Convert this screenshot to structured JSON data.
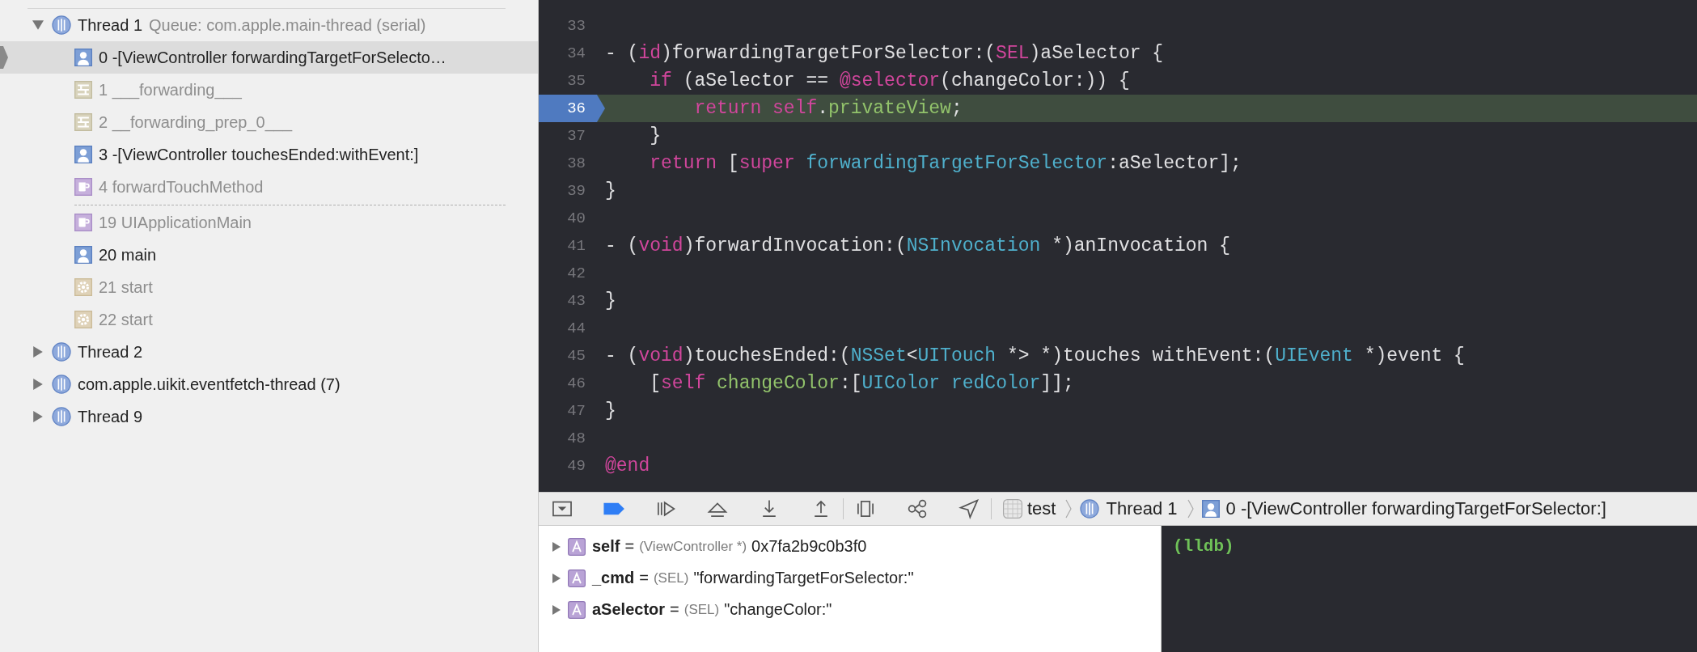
{
  "threads": [
    {
      "name": "Thread 1",
      "queue": "Queue: com.apple.main-thread (serial)",
      "expanded": true,
      "frames": [
        {
          "label": "0 -[ViewController forwardingTargetForSelecto…",
          "kind": "user",
          "dimmed": false,
          "selected": true,
          "elided_before": false
        },
        {
          "label": "1 ___forwarding___",
          "kind": "library",
          "dimmed": true,
          "selected": false,
          "elided_before": false
        },
        {
          "label": "2 __forwarding_prep_0___",
          "kind": "library",
          "dimmed": true,
          "selected": false,
          "elided_before": false
        },
        {
          "label": "3 -[ViewController touchesEnded:withEvent:]",
          "kind": "user",
          "dimmed": false,
          "selected": false,
          "elided_before": false
        },
        {
          "label": "4 forwardTouchMethod",
          "kind": "app",
          "dimmed": true,
          "selected": false,
          "elided_before": false
        },
        {
          "label": "19 UIApplicationMain",
          "kind": "app",
          "dimmed": true,
          "selected": false,
          "elided_before": true
        },
        {
          "label": "20 main",
          "kind": "user",
          "dimmed": false,
          "selected": false,
          "elided_before": false
        },
        {
          "label": "21 start",
          "kind": "system",
          "dimmed": true,
          "selected": false,
          "elided_before": false
        },
        {
          "label": "22 start",
          "kind": "system",
          "dimmed": true,
          "selected": false,
          "elided_before": false
        }
      ]
    },
    {
      "name": "Thread 2",
      "expanded": false
    },
    {
      "name": "com.apple.uikit.eventfetch-thread (7)",
      "expanded": false
    },
    {
      "name": "Thread 9",
      "expanded": false
    }
  ],
  "editor": {
    "lines": [
      {
        "number": "33",
        "current": false
      },
      {
        "number": "34",
        "current": false,
        "tokens": [
          {
            "text": "- (",
            "kind": "plain"
          },
          {
            "text": "id",
            "kind": "keyword"
          },
          {
            "text": ")forwardingTargetForSelector:(",
            "kind": "plain"
          },
          {
            "text": "SEL",
            "kind": "keyword"
          },
          {
            "text": ")aSelector {",
            "kind": "plain"
          }
        ]
      },
      {
        "number": "35",
        "current": false,
        "tokens": [
          {
            "text": "    if",
            "kind": "keyword"
          },
          {
            "text": " (aSelector == ",
            "kind": "plain"
          },
          {
            "text": "@selector",
            "kind": "keyword"
          },
          {
            "text": "(changeColor:)) {",
            "kind": "plain"
          }
        ]
      },
      {
        "number": "36",
        "current": true,
        "tokens": [
          {
            "text": "        return self",
            "kind": "keyword"
          },
          {
            "text": ".",
            "kind": "plain"
          },
          {
            "text": "privateView",
            "kind": "member"
          },
          {
            "text": ";",
            "kind": "plain"
          }
        ]
      },
      {
        "number": "37",
        "current": false,
        "tokens": [
          {
            "text": "    }",
            "kind": "plain"
          }
        ]
      },
      {
        "number": "38",
        "current": false,
        "tokens": [
          {
            "text": "    return",
            "kind": "keyword"
          },
          {
            "text": " [",
            "kind": "plain"
          },
          {
            "text": "super",
            "kind": "keyword"
          },
          {
            "text": " forwardingTargetForSelector",
            "kind": "type"
          },
          {
            "text": ":aSelector];",
            "kind": "plain"
          }
        ]
      },
      {
        "number": "39",
        "current": false,
        "tokens": [
          {
            "text": "}",
            "kind": "plain"
          }
        ]
      },
      {
        "number": "40",
        "current": false
      },
      {
        "number": "41",
        "current": false,
        "tokens": [
          {
            "text": "- (",
            "kind": "plain"
          },
          {
            "text": "void",
            "kind": "keyword"
          },
          {
            "text": ")forwardInvocation:(",
            "kind": "plain"
          },
          {
            "text": "NSInvocation",
            "kind": "type"
          },
          {
            "text": " *)anInvocation {",
            "kind": "plain"
          }
        ]
      },
      {
        "number": "42",
        "current": false
      },
      {
        "number": "43",
        "current": false,
        "tokens": [
          {
            "text": "}",
            "kind": "plain"
          }
        ]
      },
      {
        "number": "44",
        "current": false
      },
      {
        "number": "45",
        "current": false,
        "tokens": [
          {
            "text": "- (",
            "kind": "plain"
          },
          {
            "text": "void",
            "kind": "keyword"
          },
          {
            "text": ")touchesEnded:(",
            "kind": "plain"
          },
          {
            "text": "NSSet",
            "kind": "type"
          },
          {
            "text": "<",
            "kind": "plain"
          },
          {
            "text": "UITouch",
            "kind": "type"
          },
          {
            "text": " *> *)touches withEvent:(",
            "kind": "plain"
          },
          {
            "text": "UIEvent",
            "kind": "type"
          },
          {
            "text": " *)event {",
            "kind": "plain"
          }
        ]
      },
      {
        "number": "46",
        "current": false,
        "tokens": [
          {
            "text": "    [",
            "kind": "plain"
          },
          {
            "text": "self",
            "kind": "keyword"
          },
          {
            "text": " changeColor",
            "kind": "member"
          },
          {
            "text": ":[",
            "kind": "plain"
          },
          {
            "text": "UIColor redColor",
            "kind": "type"
          },
          {
            "text": "]];",
            "kind": "plain"
          }
        ]
      },
      {
        "number": "47",
        "current": false,
        "tokens": [
          {
            "text": "}",
            "kind": "plain"
          }
        ]
      },
      {
        "number": "48",
        "current": false
      },
      {
        "number": "49",
        "current": false,
        "tokens": [
          {
            "text": "@end",
            "kind": "keyword"
          }
        ]
      }
    ]
  },
  "debug_bar": {
    "breakpoints_active": true,
    "path": [
      {
        "label": "test",
        "kind": "app"
      },
      {
        "label": "Thread 1",
        "kind": "thread"
      },
      {
        "label": "0 -[ViewController forwardingTargetForSelector:]",
        "kind": "user"
      }
    ]
  },
  "variables": [
    {
      "name": "self",
      "equals": "=",
      "type": "(ViewController *)",
      "value": "0x7fa2b9c0b3f0",
      "expanded": false
    },
    {
      "name": "_cmd",
      "equals": "=",
      "type": "(SEL)",
      "value": "\"forwardingTargetForSelector:\"",
      "expanded": false
    },
    {
      "name": "aSelector",
      "equals": "=",
      "type": "(SEL)",
      "value": "\"changeColor:\"",
      "expanded": false
    }
  ],
  "console": {
    "prompt": "(lldb)"
  }
}
